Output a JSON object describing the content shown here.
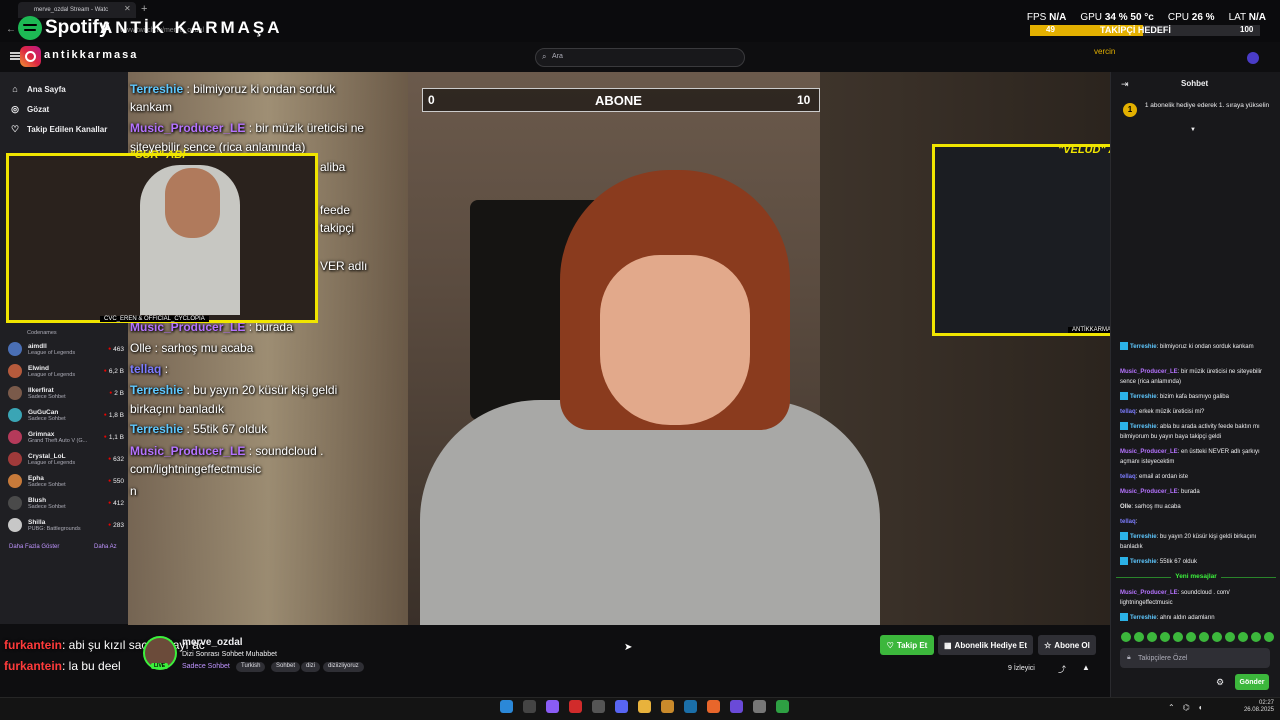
{
  "browser": {
    "tab_title": "merve_ozdal Stream - Watc",
    "address_text": "www.twitch.tv/merve_ozdal"
  },
  "overlay": {
    "spotify_label": "Spotify",
    "channel_brand": "ANTİK KARMAŞA",
    "instagram_handle": "antikkarmasa",
    "hud": {
      "fps_label": "FPS",
      "fps_value": "N/A",
      "gpu_label": "GPU",
      "gpu_value": "34 % 50 °c",
      "cpu_label": "CPU",
      "cpu_value": "26 %",
      "lat_label": "LAT",
      "lat_value": "N/A"
    },
    "follow_goal": {
      "current": "49",
      "label": "TAKİPÇİ HEDEFİ",
      "target": "100",
      "progress": 0.49
    },
    "sub_goal": {
      "min": "0",
      "label": "ABONE",
      "max": "10"
    },
    "cam_left": {
      "title": "\"SUR\" ABİ",
      "credit": "CVC_EREN & OFFICIAL_CYCLOPIA"
    },
    "cam_right": {
      "title": "\"VELUD\" ABİ",
      "credit": "ANTİKKARMAŞA"
    },
    "chat_lines": [
      {
        "user": "Terreshie",
        "text": ": bilmiyoruz ki ondan sorduk",
        "cls": "u1"
      },
      {
        "user": "",
        "text": "kankam",
        "cls": ""
      },
      {
        "user": "Music_Producer_LE",
        "text": ": bir müzik üreticisi ne",
        "cls": "u2"
      },
      {
        "user": "",
        "text": "siteyebilir sence (rica anlamında)",
        "cls": ""
      },
      {
        "user": "",
        "text": "aliba",
        "cls": ""
      },
      {
        "user": "",
        "text": "feede",
        "cls": ""
      },
      {
        "user": "",
        "text": "takipçi",
        "cls": ""
      },
      {
        "user": "",
        "text": "VER adlı",
        "cls": ""
      },
      {
        "user": "Music_Producer_LE",
        "text": ": burada",
        "cls": "u2"
      },
      {
        "user": "",
        "text": "Olle : sarhoş mu acaba",
        "cls": ""
      },
      {
        "user": "tellaq",
        "text": ":",
        "cls": "u3"
      },
      {
        "user": "Terreshie",
        "text": ": bu yayın 20 küsür kişi geldi",
        "cls": "u1"
      },
      {
        "user": "",
        "text": "birkaçını banladık",
        "cls": ""
      },
      {
        "user": "Terreshie",
        "text": ": 55tik 67 olduk",
        "cls": "u1"
      },
      {
        "user": "Music_Producer_LE",
        "text": ": soundcloud .",
        "cls": "u2"
      },
      {
        "user": "",
        "text": "com/lightningeffectmusic",
        "cls": ""
      },
      {
        "user": "",
        "text": "n",
        "cls": ""
      }
    ],
    "bottom_chat": [
      {
        "user": "furkantein",
        "text": ": abi şu kızıl saçlı ablayı ac"
      },
      {
        "user": "furkantein",
        "text": ": la bu deel"
      }
    ]
  },
  "header": {
    "search_placeholder": "Ara",
    "user_name": "vercin"
  },
  "sidebar": {
    "nav": [
      {
        "icon": "home-icon",
        "glyph": "⌂",
        "label": "Ana Sayfa"
      },
      {
        "icon": "compass-icon",
        "glyph": "◎",
        "label": "Gözat"
      },
      {
        "icon": "heart-icon",
        "glyph": "♡",
        "label": "Takip Edilen Kanallar"
      }
    ],
    "codenames_label": "Codenames",
    "channels": [
      {
        "name": "aimdll",
        "game": "League of Legends",
        "viewers": "463",
        "color": "#4a6fb5"
      },
      {
        "name": "Elwind",
        "game": "League of Legends",
        "viewers": "6,2 B",
        "color": "#b55a3c"
      },
      {
        "name": "Ilkerfirat",
        "game": "Sadece Sohbet",
        "viewers": "2 B",
        "color": "#7a5a4a"
      },
      {
        "name": "GuGuCan",
        "game": "Sadece Sohbet",
        "viewers": "1,8 B",
        "color": "#3aa5b5"
      },
      {
        "name": "Grimnax",
        "game": "Grand Theft Auto V (G...",
        "viewers": "1,1 B",
        "color": "#b53a5a"
      },
      {
        "name": "Crystal_LoL",
        "game": "League of Legends",
        "viewers": "632",
        "color": "#a03a3a"
      },
      {
        "name": "Epha",
        "game": "Sadece Sohbet",
        "viewers": "550",
        "color": "#c77a3a"
      },
      {
        "name": "Blush",
        "game": "Sadece Sohbet",
        "viewers": "412",
        "color": "#4a4a4a"
      },
      {
        "name": "Shilla",
        "game": "PUBG: Battlegrounds",
        "viewers": "283",
        "color": "#c7c7c7"
      }
    ],
    "show_more": "Daha Fazla Göster",
    "show_less": "Daha Az"
  },
  "channel": {
    "name": "merve_ozdal",
    "title": "Dizi Sonrası Sohbet Muhabbet",
    "category": "Sadece Sohbet",
    "live_label": "LIVE",
    "tags": [
      "Turkish",
      "Sohbet",
      "dizi",
      "diziizliyoruz"
    ],
    "follow_label": "Takip Et",
    "gift_label": "Abonelik Hediye Et",
    "subscribe_label": "Abone Ol",
    "viewers": "9 İzleyici"
  },
  "chat": {
    "title": "Sohbet",
    "gift_banner": "1 abonelik hediye ederek 1. sıraya yükselin",
    "gift_rank": "1",
    "messages": [
      {
        "user": "Terreshie",
        "text": ": bilmiyoruz ki ondan sorduk kankam",
        "cls": "u1",
        "badge": true
      },
      {
        "user": "Music_Producer_LE",
        "text": ": bir müzik üreticisi ne siteyebilir sence (rica anlamında)",
        "cls": "u2",
        "badge": false
      },
      {
        "user": "Terreshie",
        "text": ": bizim kafa basmıyo galiba",
        "cls": "u1",
        "badge": true
      },
      {
        "user": "tellaq",
        "text": ": erkek müzik üreticisi mi?",
        "cls": "u3",
        "badge": false
      },
      {
        "user": "Terreshie",
        "text": ": abla bu arada activity feede baktın mı bilmiyorum bu yayın baya takipçi geldi",
        "cls": "u1",
        "badge": true
      },
      {
        "user": "Music_Producer_LE",
        "text": ": en üstteki NEVER adlı şarkıyı açmanı isteyecektim",
        "cls": "u2",
        "badge": false
      },
      {
        "user": "tellaq",
        "text": ": email at ordan iste",
        "cls": "u3",
        "badge": false
      },
      {
        "user": "Music_Producer_LE",
        "text": ": burada",
        "cls": "u2",
        "badge": false
      },
      {
        "user": "Olle",
        "text": ": sarhoş mu acaba",
        "cls": "u4",
        "badge": false
      },
      {
        "user": "tellaq",
        "text": ":",
        "cls": "u3",
        "badge": false
      },
      {
        "user": "Terreshie",
        "text": ": bu yayın 20 küsür kişi geldi birkaçını banladık",
        "cls": "u1",
        "badge": true
      },
      {
        "user": "Terreshie",
        "text": ": 55tik 67 olduk",
        "cls": "u1",
        "badge": true
      }
    ],
    "new_messages_label": "Yeni mesajlar",
    "new_messages": [
      {
        "user": "Music_Producer_LE",
        "text": ": soundcloud . com/ lightningeffectmusic",
        "cls": "u2",
        "badge": false
      },
      {
        "user": "Terreshie",
        "text": ": ahnı aldın adamların",
        "cls": "u1",
        "badge": true
      }
    ],
    "input_placeholder": "Takipçilere Özel",
    "send_label": "Gönder"
  },
  "taskbar": {
    "time": "02:27",
    "date": "26.08.2025"
  },
  "colors": {
    "accent_green": "#3cb73c",
    "twitch_purple": "#bf94ff",
    "overlay_yellow": "#f0e500",
    "live_red": "#eb0400"
  }
}
